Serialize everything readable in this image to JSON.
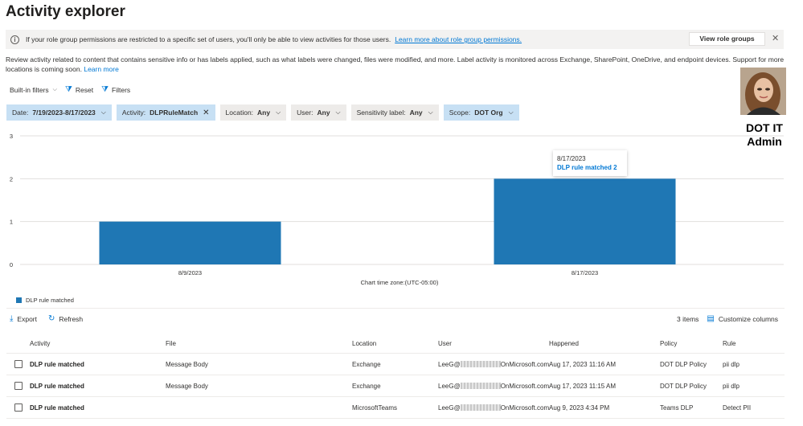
{
  "page": {
    "title": "Activity explorer"
  },
  "banner": {
    "text": "If your role group permissions are restricted to a specific set of users, you'll only be able to view activities for those users.",
    "link": "Learn more about role group permissions.",
    "button": "View role groups"
  },
  "description": {
    "text": "Review activity related to content that contains sensitive info or has labels applied, such as what labels were changed, files were modified, and more. Label activity is monitored across Exchange, SharePoint, OneDrive, and endpoint devices. Support for more locations is coming soon.",
    "link": "Learn more"
  },
  "toolbar": {
    "builtin": "Built-in filters",
    "reset": "Reset",
    "filters": "Filters"
  },
  "filters": [
    {
      "label": "Date:",
      "value": "7/19/2023-8/17/2023"
    },
    {
      "label": "Activity:",
      "value": "DLPRuleMatch"
    },
    {
      "label": "Location:",
      "value": "Any"
    },
    {
      "label": "User:",
      "value": "Any"
    },
    {
      "label": "Sensitivity label:",
      "value": "Any"
    },
    {
      "label": "Scope:",
      "value": "DOT Org"
    }
  ],
  "admin": {
    "name": "DOT IT Admin"
  },
  "tooltip": {
    "date": "8/17/2023",
    "value": "DLP rule matched 2"
  },
  "chart_data": {
    "type": "bar",
    "categories": [
      "8/9/2023",
      "8/17/2023"
    ],
    "series": [
      {
        "name": "DLP rule matched",
        "values": [
          1,
          2
        ],
        "color": "#1f77b4"
      }
    ],
    "ylim": [
      0,
      3
    ],
    "yticks": [
      "0",
      "1",
      "2",
      "3"
    ],
    "xlabel": "Chart time zone:(UTC-05:00)",
    "legend": "bottom-left",
    "grid": true
  },
  "actions": {
    "export": "Export",
    "refresh": "Refresh",
    "count": "3 items",
    "customize": "Customize columns"
  },
  "table": {
    "headers": [
      "Activity",
      "File",
      "Location",
      "User",
      "Happened",
      "Policy",
      "Rule"
    ],
    "rows": [
      {
        "activity": "DLP rule matched",
        "file": "Message Body",
        "location": "Exchange",
        "user_prefix": "LeeG@",
        "user_suffix": "OnMicrosoft.com",
        "happened": "Aug 17, 2023 11:16 AM",
        "policy": "DOT DLP Policy",
        "rule": "pii dlp"
      },
      {
        "activity": "DLP rule matched",
        "file": "Message Body",
        "location": "Exchange",
        "user_prefix": "LeeG@",
        "user_suffix": "OnMicrosoft.com",
        "happened": "Aug 17, 2023 11:15 AM",
        "policy": "DOT DLP Policy",
        "rule": "pii dlp"
      },
      {
        "activity": "DLP rule matched",
        "file": "",
        "location": "MicrosoftTeams",
        "user_prefix": "LeeG@",
        "user_suffix": "OnMicrosoft.com",
        "happened": "Aug 9, 2023 4:34 PM",
        "policy": "Teams DLP",
        "rule": "Detect PII"
      }
    ]
  }
}
